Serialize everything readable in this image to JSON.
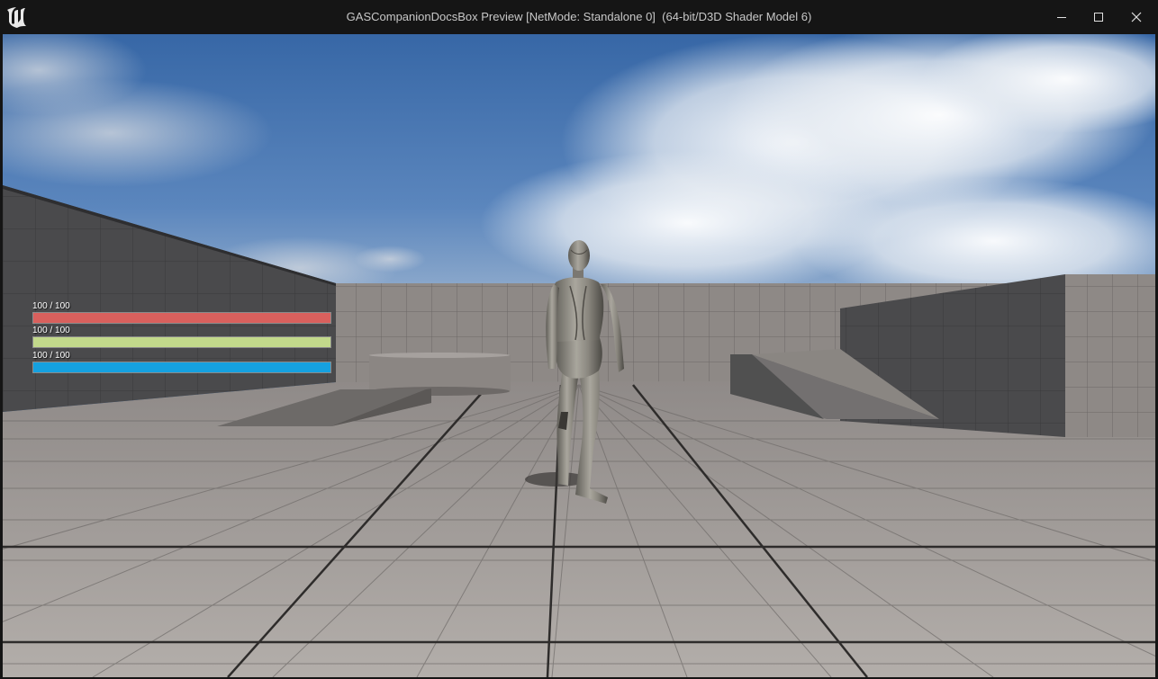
{
  "window": {
    "title": "GASCompanionDocsBox Preview [NetMode: Standalone 0]  (64-bit/D3D Shader Model 6)",
    "icons": {
      "logo": "unreal-engine-logo-icon",
      "minimize": "minimize-icon",
      "maximize": "maximize-icon",
      "close": "close-icon"
    }
  },
  "hud": {
    "health": {
      "label": "100 / 100",
      "current": 100,
      "max": 100,
      "color": "#d9605d"
    },
    "stamina": {
      "label": "100 / 100",
      "current": 100,
      "max": 100,
      "color": "#c2d98b"
    },
    "mana": {
      "label": "100 / 100",
      "current": 100,
      "max": 100,
      "color": "#15a1e0"
    }
  },
  "colors": {
    "titlebar": "#151515",
    "title_text": "#c8c8c8",
    "sky_top": "#3767a6",
    "floor": "#a9a4a1",
    "wall": "#4a4a4c"
  }
}
